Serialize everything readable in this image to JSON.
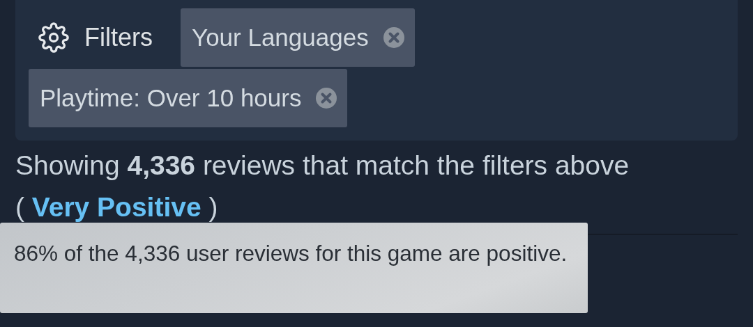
{
  "filters": {
    "label": "Filters",
    "chips": [
      {
        "label": "Your Languages"
      },
      {
        "label": "Playtime: Over 10 hours"
      }
    ]
  },
  "summary": {
    "text": "Showing **4,336** reviews that match the filters above",
    "open": "(",
    "rating": "Very Positive",
    "close": ")"
  },
  "tooltip": {
    "text": "86% of the 4,336 user reviews for this game are positive."
  }
}
